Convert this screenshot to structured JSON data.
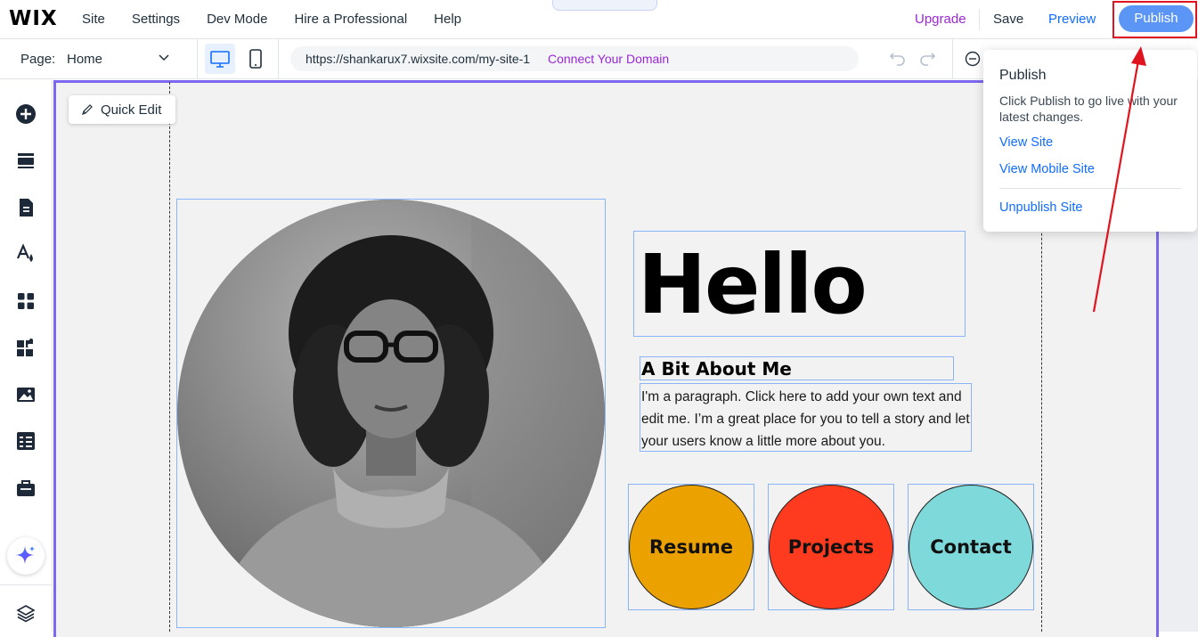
{
  "topbar": {
    "logo": "WIX",
    "nav": [
      "Site",
      "Settings",
      "Dev Mode",
      "Hire a Professional",
      "Help"
    ],
    "collapse_glyph": "⌃",
    "upgrade": "Upgrade",
    "save": "Save",
    "preview": "Preview",
    "publish": "Publish"
  },
  "pagebar": {
    "page_label": "Page:",
    "page_value": "Home",
    "url": "https://shankarux7.wixsite.com/my-site-1",
    "connect_domain": "Connect Your Domain"
  },
  "sidebar": {
    "icons": [
      "add-icon",
      "sections-icon",
      "pages-icon",
      "design-icon",
      "apps-icon",
      "app-market-icon",
      "media-icon",
      "cms-icon",
      "business-icon",
      "ai-assistant-icon",
      "layers-icon"
    ]
  },
  "canvas": {
    "quick_edit": "Quick Edit",
    "hello": "Hello",
    "about_title": "A Bit About Me",
    "paragraph": "I'm a paragraph. Click here to add your own text and edit me. I’m a great place for you to tell a story and let your users know a little more about you.",
    "buttons": [
      {
        "label": "Resume",
        "color": "#EBA100"
      },
      {
        "label": "Projects",
        "color": "#FF3B1F"
      },
      {
        "label": "Contact",
        "color": "#7ED9DB"
      }
    ]
  },
  "popover": {
    "title": "Publish",
    "description": "Click Publish to go live with your latest changes.",
    "view_site": "View Site",
    "view_mobile_site": "View Mobile Site",
    "unpublish_site": "Unpublish Site"
  },
  "colors": {
    "accent_blue": "#116DFF",
    "upgrade_purple": "#9A27D5",
    "publish_button": "#5B96F7",
    "highlight_red": "#E0141E",
    "frame_purple": "#7B68EE"
  }
}
